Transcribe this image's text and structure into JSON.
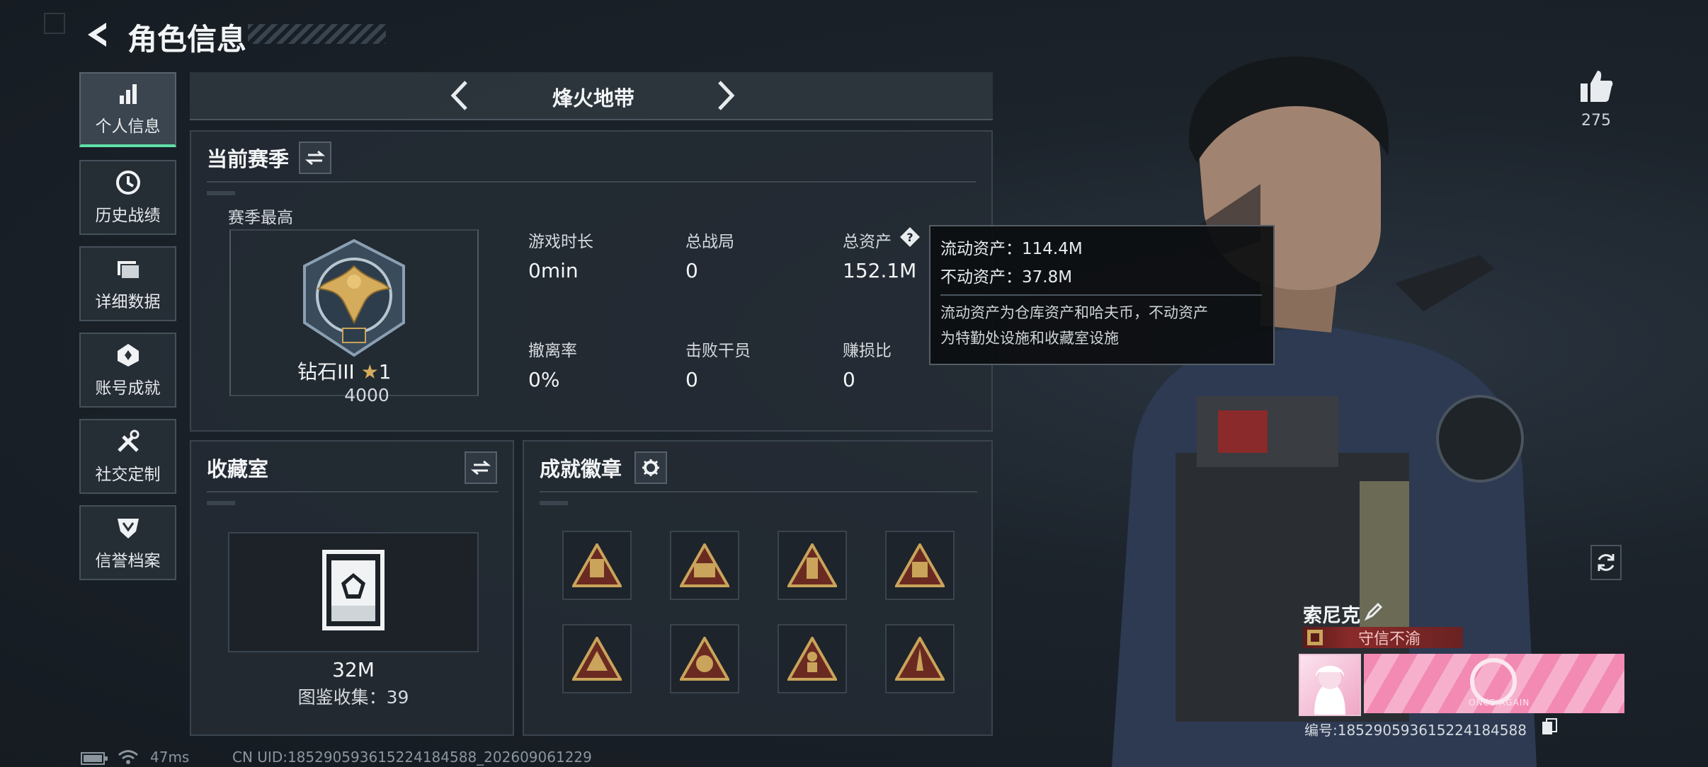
{
  "header": {
    "title": "角色信息"
  },
  "mode_selector": {
    "mode": "烽火地带"
  },
  "sidebar": {
    "items": [
      {
        "label": "个人信息",
        "icon": "bar-chart-icon",
        "active": true
      },
      {
        "label": "历史战绩",
        "icon": "clock-icon",
        "active": false
      },
      {
        "label": "详细数据",
        "icon": "folder-icon",
        "active": false
      },
      {
        "label": "账号成就",
        "icon": "medal-icon",
        "active": false
      },
      {
        "label": "社交定制",
        "icon": "tools-icon",
        "active": false
      },
      {
        "label": "信誉档案",
        "icon": "shield-icon",
        "active": false
      }
    ]
  },
  "season": {
    "title": "当前赛季",
    "best_label": "赛季最高",
    "rank_name": "钻石III",
    "rank_stars": "1",
    "rank_points": "4000",
    "stats": [
      {
        "label": "游戏时长",
        "value": "0min"
      },
      {
        "label": "总战局",
        "value": "0"
      },
      {
        "label": "总资产",
        "value": "152.1M"
      },
      {
        "label": "撤离率",
        "value": "0%"
      },
      {
        "label": "击败干员",
        "value": "0"
      },
      {
        "label": "赚损比",
        "value": "0"
      }
    ]
  },
  "asset_tooltip": {
    "liquid": "流动资产：114.4M",
    "fixed": "不动资产：37.8M",
    "desc_line1": "流动资产为仓库资产和哈夫币，不动资产",
    "desc_line2": "为特勤处设施和收藏室设施"
  },
  "collection": {
    "title": "收藏室",
    "value": "32M",
    "count": "图鉴收集：39"
  },
  "achievements": {
    "title": "成就徽章",
    "badge_count": 8
  },
  "likes": {
    "count": "275"
  },
  "player": {
    "name": "索尼克",
    "title_badge": "守信不渝",
    "id": "编号:1852905936152241845​88",
    "banner_text": "ONCE AGAIN"
  },
  "status_bar": {
    "ping": "47ms",
    "uid": "CN UID:1852905936152241845​88_202609061229"
  },
  "colors": {
    "accent": "#5fe0a6",
    "gold": "#c9a45a",
    "pink": "#f2a9c8",
    "title_red": "#8a2a2a"
  }
}
